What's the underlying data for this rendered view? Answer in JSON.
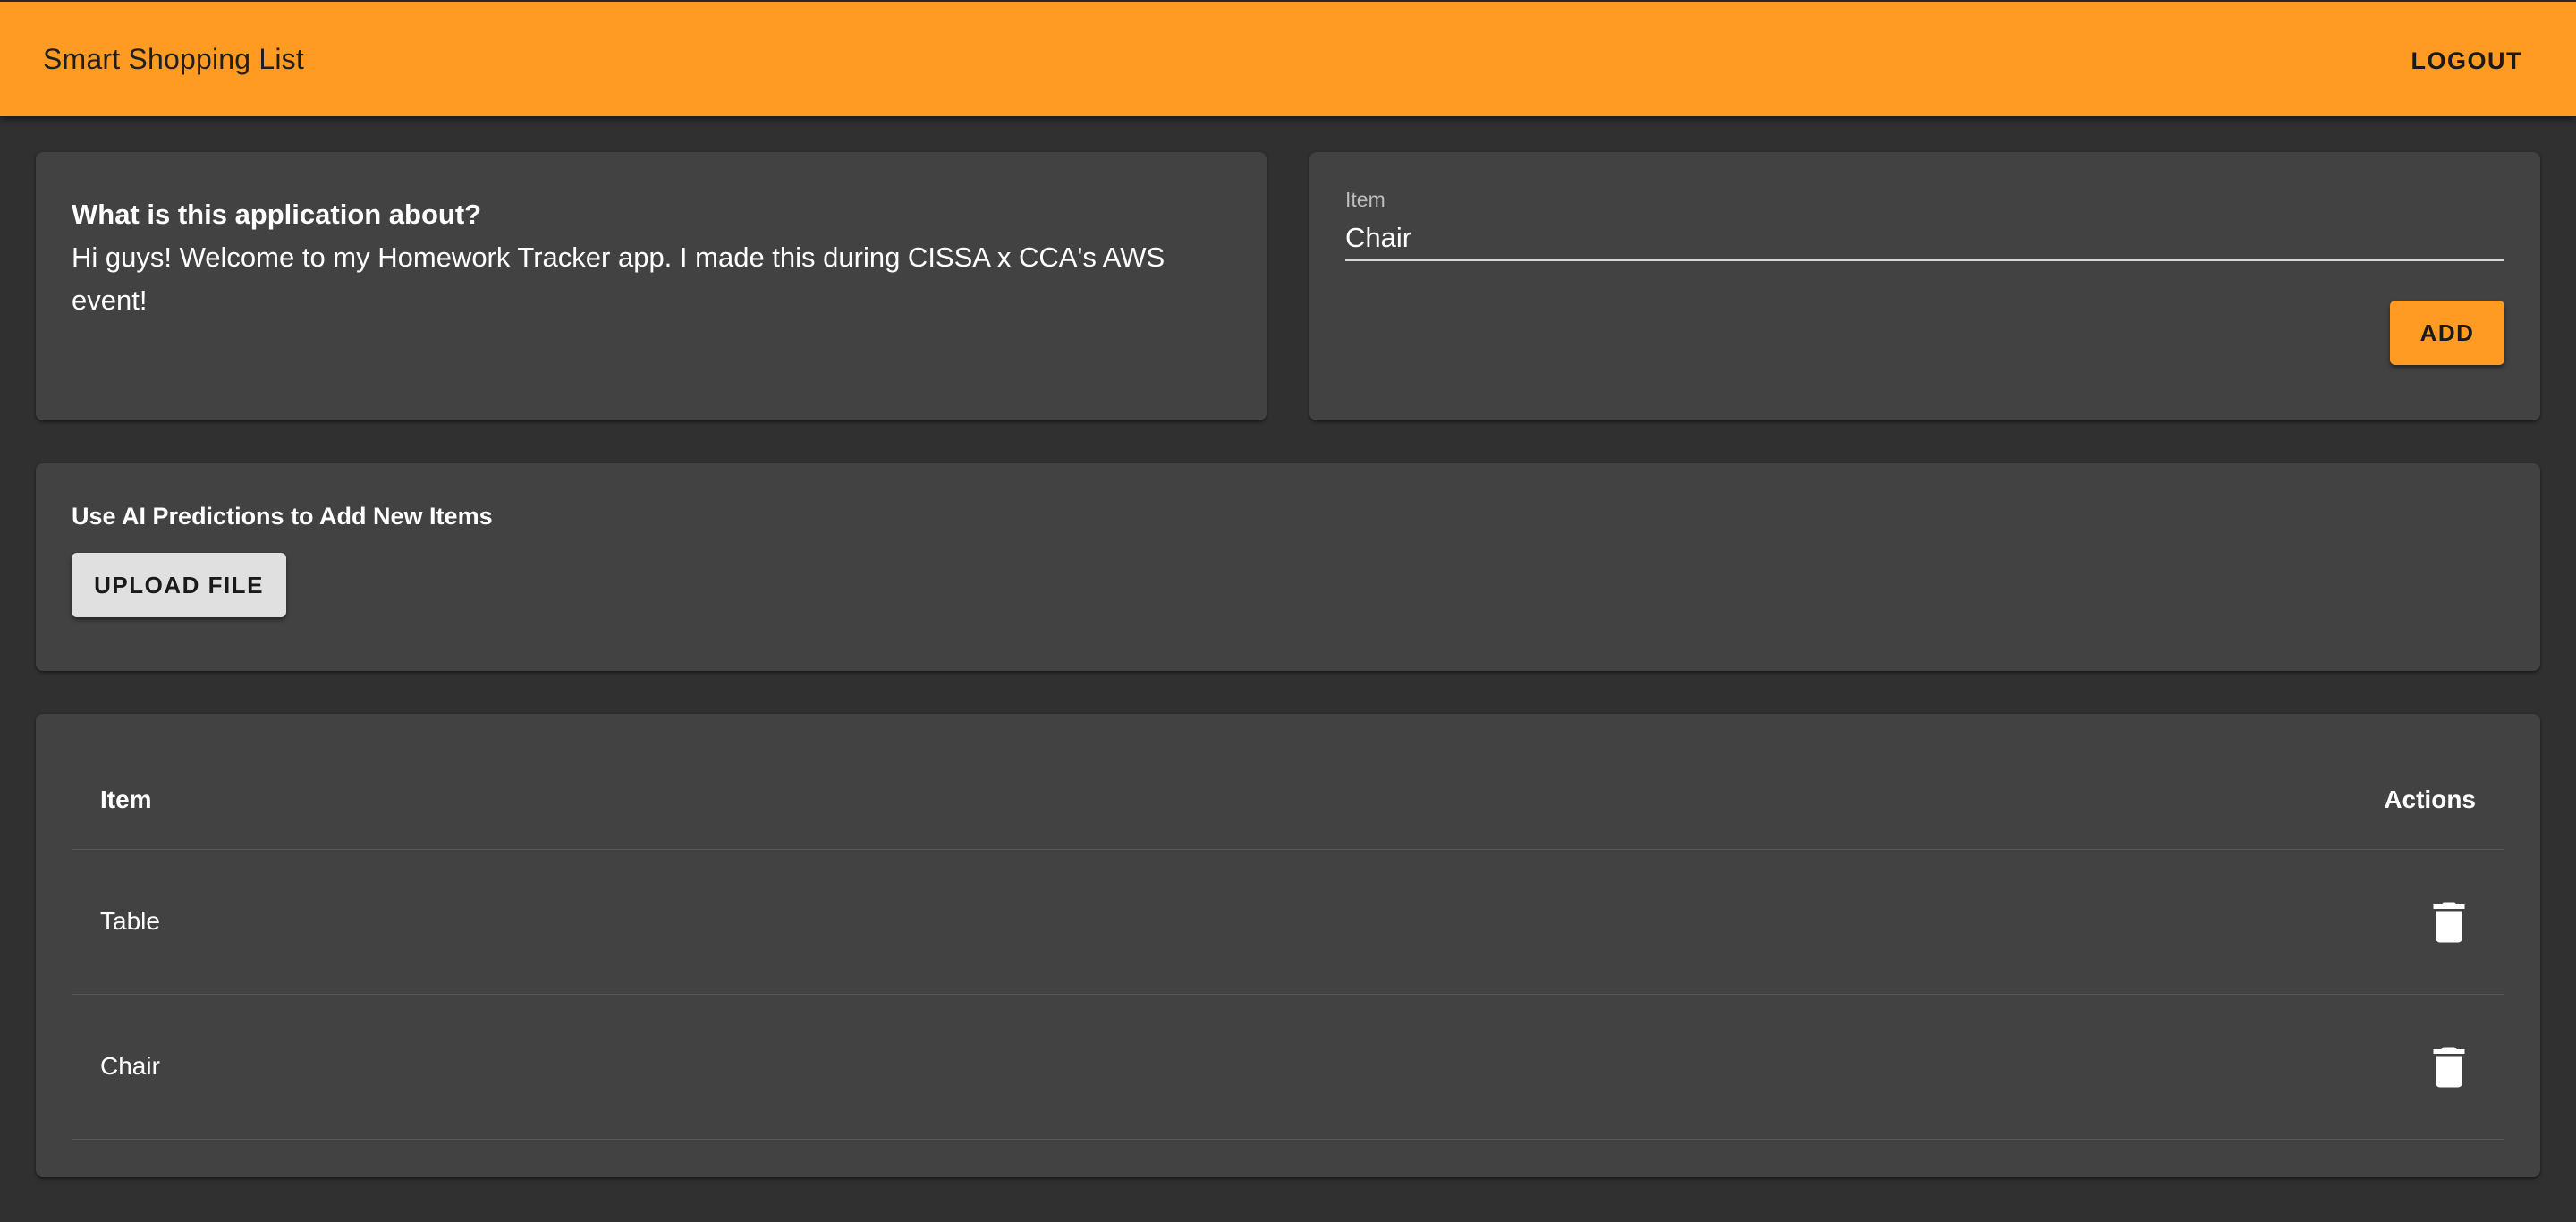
{
  "appbar": {
    "title": "Smart Shopping List",
    "logout_label": "LOGOUT",
    "color": "#ff9a22"
  },
  "about": {
    "title": "What is this application about?",
    "body": "Hi guys! Welcome to my Homework Tracker app. I made this during CISSA x CCA's AWS event!"
  },
  "add_form": {
    "field_label": "Item",
    "field_value": "Chair",
    "add_label": "ADD"
  },
  "ai": {
    "heading": "Use AI Predictions to Add New Items",
    "upload_label": "UPLOAD FILE"
  },
  "table": {
    "columns": [
      "Item",
      "Actions"
    ],
    "rows": [
      {
        "item": "Table",
        "action_icon": "delete-icon"
      },
      {
        "item": "Chair",
        "action_icon": "delete-icon"
      }
    ]
  },
  "colors": {
    "background": "#303030",
    "card": "#424242",
    "accent": "#ff9a22"
  }
}
